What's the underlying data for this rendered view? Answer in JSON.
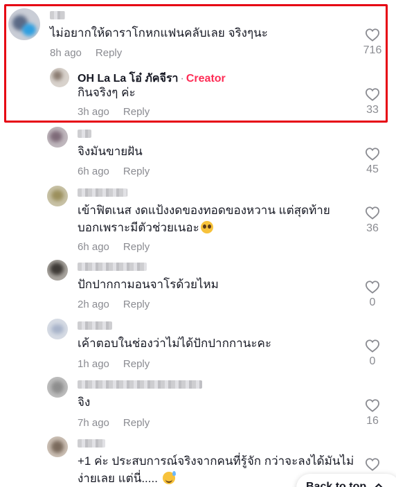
{
  "comments": [
    {
      "text": "ไม่อยากให้ดาราโกหกแฟนคลับเลย จริงๆนะ",
      "time": "8h ago",
      "reply": "Reply",
      "likes": "716"
    },
    {
      "author": "OH La La โอ๋ ภัคจีรา",
      "badge": "Creator",
      "sep": "·",
      "text": "กินจริงๆ ค่ะ",
      "time": "3h ago",
      "reply": "Reply",
      "likes": "33"
    },
    {
      "text": "จิงมันขายฝัน",
      "time": "6h ago",
      "reply": "Reply",
      "likes": "45"
    },
    {
      "text": "เข้าฟิตเนส งดแป้งงดของทอดของหวาน แต่สุดท้าย",
      "text2": "บอกเพราะมีตัวช่วยเนอะ",
      "time": "6h ago",
      "reply": "Reply",
      "likes": "36"
    },
    {
      "text": "ปักปากกามอนจาโรด้วยไหม",
      "time": "2h ago",
      "reply": "Reply",
      "likes": "0"
    },
    {
      "text": "เค้าตอบในช่องว่าไม่ได้ปักปากกานะคะ",
      "time": "1h ago",
      "reply": "Reply",
      "likes": "0"
    },
    {
      "text": "จิง",
      "time": "7h ago",
      "reply": "Reply",
      "likes": "16"
    },
    {
      "text": "+1 ค่ะ ประสบการณ์จริงจากคนที่รู้จัก กว่าจะลงได้มันไม่",
      "text2": "ง่ายเลย แต่นี่..... "
    }
  ],
  "back_to_top": "Back to top",
  "icons": {
    "like": "heart-outline-icon",
    "back_to_top": "chevron-up-icon"
  },
  "colors": {
    "highlight": "#e60012",
    "creator": "#fe2c55",
    "muted": "#8a8b91"
  }
}
